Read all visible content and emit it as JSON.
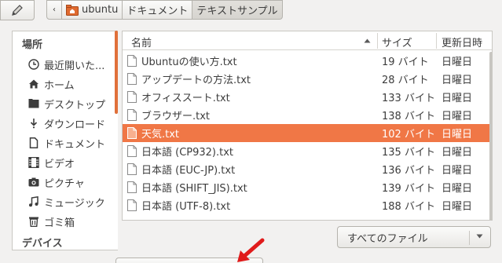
{
  "pathbar": {
    "crumbs": [
      "ubuntu",
      "ドキュメント",
      "テキストサンプル"
    ]
  },
  "sidebar": {
    "heading_places": "場所",
    "items": [
      {
        "label": "最近開いた...",
        "icon": "clock-icon"
      },
      {
        "label": "ホーム",
        "icon": "home-icon"
      },
      {
        "label": "デスクトップ",
        "icon": "desktop-icon"
      },
      {
        "label": "ダウンロード",
        "icon": "download-icon"
      },
      {
        "label": "ドキュメント",
        "icon": "document-icon"
      },
      {
        "label": "ビデオ",
        "icon": "video-icon"
      },
      {
        "label": "ピクチャ",
        "icon": "camera-icon"
      },
      {
        "label": "ミュージック",
        "icon": "music-icon"
      },
      {
        "label": "ゴミ箱",
        "icon": "trash-icon"
      }
    ],
    "heading_devices": "デバイス"
  },
  "filelist": {
    "columns": {
      "name": "名前",
      "size": "サイズ",
      "modified": "更新日時"
    },
    "rows": [
      {
        "name": "Ubuntuの使い方.txt",
        "size": "19 バイト",
        "modified": "日曜日"
      },
      {
        "name": "アップデートの方法.txt",
        "size": "28 バイト",
        "modified": "日曜日"
      },
      {
        "name": "オフィススート.txt",
        "size": "133 バイト",
        "modified": "日曜日"
      },
      {
        "name": "ブラウザー.txt",
        "size": "138 バイト",
        "modified": "日曜日"
      },
      {
        "name": "天気.txt",
        "size": "102 バイト",
        "modified": "日曜日",
        "selected": true
      },
      {
        "name": "日本語 (CP932).txt",
        "size": "135 バイト",
        "modified": "日曜日"
      },
      {
        "name": "日本語 (EUC-JP).txt",
        "size": "136 バイト",
        "modified": "日曜日"
      },
      {
        "name": "日本語 (SHIFT_JIS).txt",
        "size": "139 バイト",
        "modified": "日曜日"
      },
      {
        "name": "日本語 (UTF-8).txt",
        "size": "188 バイト",
        "modified": "日曜日"
      }
    ]
  },
  "filter": {
    "value": "すべてのファイル"
  },
  "colors": {
    "accent": "#f07746",
    "arrow": "#e01b1b"
  }
}
